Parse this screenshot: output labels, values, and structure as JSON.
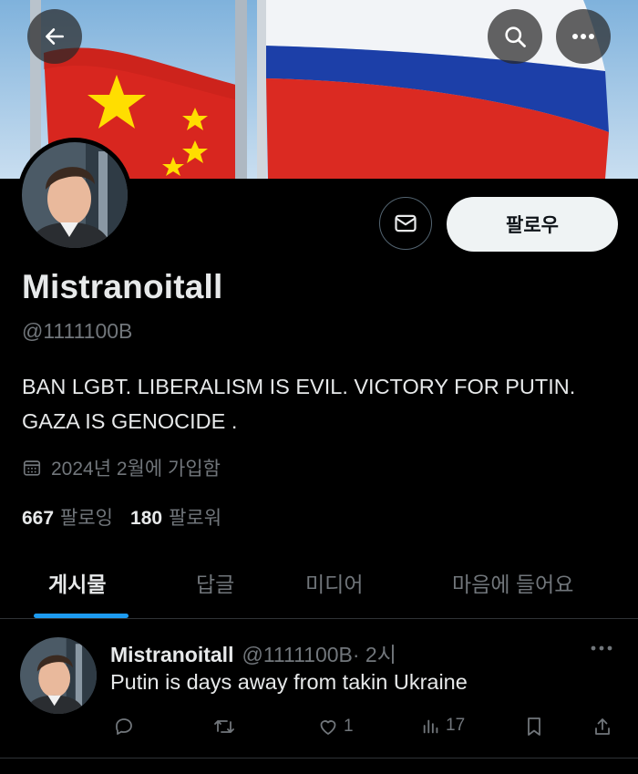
{
  "profile": {
    "display_name": "Mistranoitall",
    "handle": "@1111100B",
    "bio": "BAN LGBT. LIBERALISM IS EVIL. VICTORY FOR PUTIN. GAZA IS GENOCIDE .",
    "joined": "2024년 2월에 가입함",
    "following_count": "667",
    "following_label": "팔로잉",
    "followers_count": "180",
    "followers_label": "팔로워",
    "follow_label": "팔로우"
  },
  "header": {
    "icons": [
      "back-arrow-icon",
      "search-icon",
      "more-icon"
    ]
  },
  "tabs": [
    {
      "label": "게시물",
      "active": true
    },
    {
      "label": "답글",
      "active": false
    },
    {
      "label": "미디어",
      "active": false
    },
    {
      "label": "마음에 들어요",
      "active": false
    }
  ],
  "tweet": {
    "name": "Mistranoitall",
    "handle": "@1111100B",
    "time": " · 2시",
    "text": "Putin is days away from takin Ukraine",
    "replies": "",
    "retweets": "",
    "likes": "1",
    "views": "17"
  },
  "colors": {
    "accent": "#1d9bf0",
    "background": "#000000",
    "text": "#e7e9ea",
    "muted": "#71767b",
    "follow_button_bg": "#eff3f4"
  }
}
